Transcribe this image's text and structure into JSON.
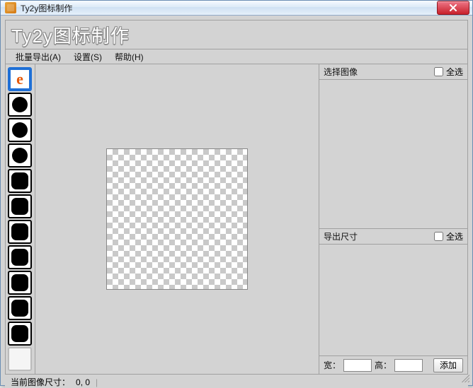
{
  "window": {
    "title": "Ty2y图标制作"
  },
  "brand": {
    "title": "Ty2y图标制作"
  },
  "menu": {
    "batch_export": "批量导出(A)",
    "settings": "设置(S)",
    "help": "帮助(H)"
  },
  "tools": {
    "selected_index": 0,
    "items": [
      {
        "name": "e-shape",
        "shape": "e"
      },
      {
        "name": "slot-1",
        "shape": "circle"
      },
      {
        "name": "slot-2",
        "shape": "circle"
      },
      {
        "name": "slot-3",
        "shape": "circle"
      },
      {
        "name": "slot-4",
        "shape": "rounded"
      },
      {
        "name": "slot-5",
        "shape": "rounded"
      },
      {
        "name": "slot-6",
        "shape": "rounded"
      },
      {
        "name": "slot-7",
        "shape": "rounded"
      },
      {
        "name": "slot-8",
        "shape": "rounded"
      },
      {
        "name": "slot-9",
        "shape": "rounded"
      },
      {
        "name": "slot-10",
        "shape": "rounded"
      },
      {
        "name": "slot-empty",
        "shape": "empty"
      }
    ]
  },
  "panels": {
    "select_image": {
      "title": "选择图像",
      "select_all_label": "全选",
      "select_all_checked": false
    },
    "export_size": {
      "title": "导出尺寸",
      "select_all_label": "全选",
      "select_all_checked": false
    }
  },
  "dimensions": {
    "width_label": "宽：",
    "width_value": "",
    "height_label": "高：",
    "height_value": "",
    "add_label": "添加"
  },
  "status": {
    "current_label": "当前图像尺寸：",
    "current_value": "0, 0"
  }
}
